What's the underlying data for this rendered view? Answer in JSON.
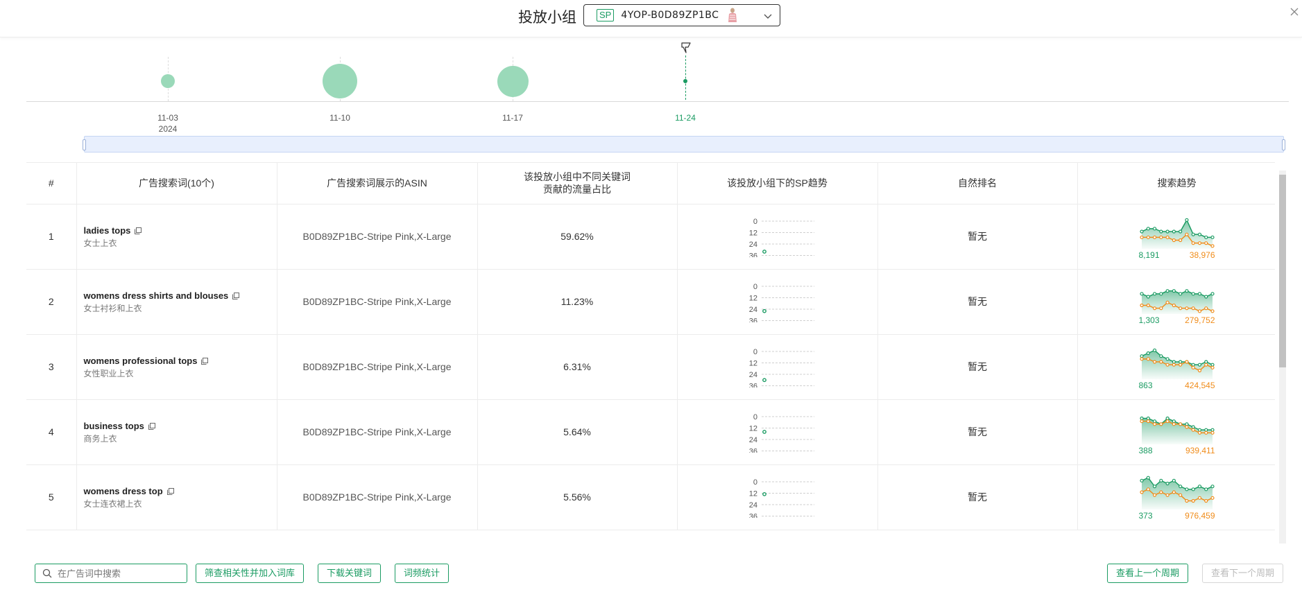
{
  "header": {
    "title": "投放小组",
    "group_badge": "SP",
    "group_id": "4YOP-B0D89ZP1BC"
  },
  "timeline": {
    "dates": [
      {
        "label": "11-03",
        "year": "2024",
        "bubble": 0.4
      },
      {
        "label": "11-10",
        "year": "",
        "bubble": 1.0
      },
      {
        "label": "11-17",
        "year": "",
        "bubble": 0.9
      },
      {
        "label": "11-24",
        "year": "",
        "bubble": 0,
        "active": true
      }
    ]
  },
  "table": {
    "headers": {
      "index": "#",
      "keyword": "广告搜索词(10个)",
      "asin": "广告搜索词展示的ASIN",
      "share_line1": "该投放小组中不同关键词",
      "share_line2": "贡献的流量占比",
      "sp_trend": "该投放小组下的SP趋势",
      "natural_rank": "自然排名",
      "search_trend": "搜索趋势"
    },
    "sp_axis_ticks": [
      "0",
      "12",
      "24",
      "36"
    ],
    "rows": [
      {
        "index": "1",
        "kw_en": "ladies tops",
        "kw_zh": "女士上衣",
        "asin": "B0D89ZP1BC-Stripe Pink,X-Large",
        "share": "59.62%",
        "sp_rank": 32,
        "rank": "暂无",
        "trend_green_label": "8,191",
        "trend_orange_label": "38,976",
        "trend_green": [
          6,
          7,
          7,
          6,
          6,
          6,
          6,
          10,
          5,
          5,
          4,
          4
        ],
        "trend_orange": [
          4,
          4,
          4,
          4,
          4,
          3,
          3,
          5,
          2,
          2,
          2,
          1
        ]
      },
      {
        "index": "2",
        "kw_en": "womens dress shirts and blouses",
        "kw_zh": "女士衬衫和上衣",
        "asin": "B0D89ZP1BC-Stripe Pink,X-Large",
        "share": "11.23%",
        "sp_rank": 26,
        "rank": "暂无",
        "trend_green_label": "1,303",
        "trend_orange_label": "279,752",
        "trend_green": [
          7,
          6,
          7,
          7,
          8,
          8,
          7,
          8,
          7,
          7,
          6,
          7
        ],
        "trend_orange": [
          3,
          3,
          2,
          2,
          4,
          3,
          2,
          2,
          2,
          1,
          2,
          1
        ]
      },
      {
        "index": "3",
        "kw_en": "womens professional tops",
        "kw_zh": "女性职业上衣",
        "asin": "B0D89ZP1BC-Stripe Pink,X-Large",
        "share": "6.31%",
        "sp_rank": 30,
        "rank": "暂无",
        "trend_green_label": "863",
        "trend_orange_label": "424,545",
        "trend_green": [
          8,
          9,
          10,
          8,
          7,
          6,
          6,
          6,
          5,
          5,
          6,
          5
        ],
        "trend_orange": [
          7,
          7,
          6,
          6,
          5,
          5,
          5,
          6,
          4,
          3,
          5,
          4
        ]
      },
      {
        "index": "4",
        "kw_en": "business tops",
        "kw_zh": "商务上衣",
        "asin": "B0D89ZP1BC-Stripe Pink,X-Large",
        "share": "5.64%",
        "sp_rank": 16,
        "rank": "暂无",
        "trend_green_label": "388",
        "trend_orange_label": "939,411",
        "trend_green": [
          9,
          9,
          8,
          7,
          9,
          8,
          7,
          7,
          6,
          5,
          5,
          5
        ],
        "trend_orange": [
          8,
          8,
          7,
          7,
          8,
          7,
          7,
          6,
          5,
          4,
          4,
          4
        ]
      },
      {
        "index": "5",
        "kw_en": "womens dress top",
        "kw_zh": "女士连衣裙上衣",
        "asin": "B0D89ZP1BC-Stripe Pink,X-Large",
        "share": "5.56%",
        "sp_rank": 13,
        "rank": "暂无",
        "trend_green_label": "373",
        "trend_orange_label": "976,459",
        "trend_green": [
          10,
          11,
          8,
          10,
          9,
          10,
          8,
          7,
          7,
          8,
          7,
          8
        ],
        "trend_orange": [
          6,
          7,
          5,
          6,
          5,
          6,
          5,
          3,
          3,
          4,
          3,
          4
        ]
      }
    ]
  },
  "footer": {
    "search_placeholder": "在广告词中搜索",
    "btn_filter": "筛查相关性并加入词库",
    "btn_download": "下载关键词",
    "btn_stats": "词频统计",
    "btn_prev": "查看上一个周期",
    "btn_next": "查看下一个周期"
  },
  "colors": {
    "accent": "#1a9b62",
    "orange": "#f08c1a",
    "bubble": "#9ad9b9"
  },
  "icons": [
    "chevron-down-icon",
    "close-icon",
    "copy-icon",
    "search-icon",
    "pin-icon",
    "scroll-up-icon",
    "scroll-down-icon"
  ]
}
